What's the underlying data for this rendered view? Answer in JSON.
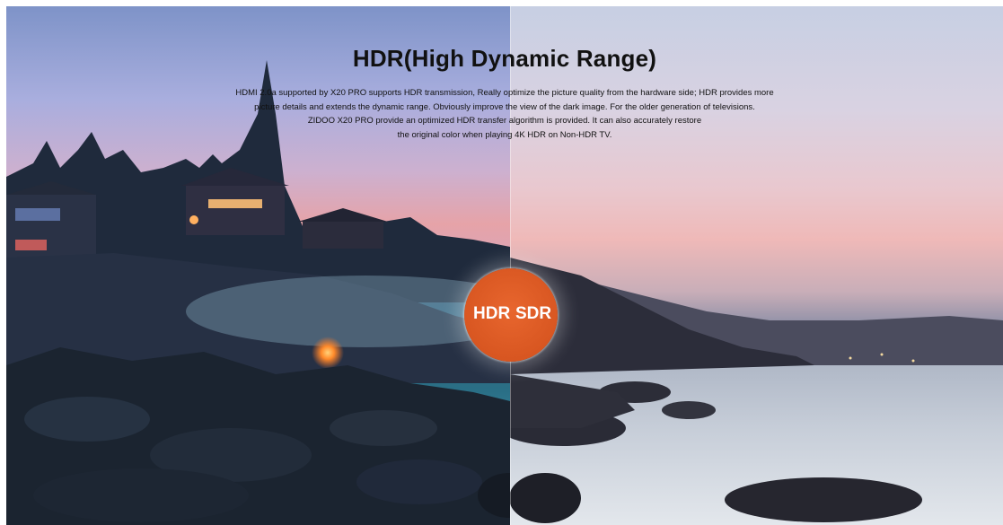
{
  "header": {
    "title": "HDR(High Dynamic Range)",
    "description_lines": [
      "HDMI 2.0a supported by X20 PRO supports HDR transmission, Really optimize the picture quality from the hardware side; HDR provides more",
      "picture details and extends the dynamic range. Obviously improve the view of the dark image. For the older generation of televisions.",
      "ZIDOO X20 PRO provide an optimized HDR transfer algorithm is provided. It can also accurately restore",
      "the original color when playing 4K HDR on Non-HDR TV."
    ]
  },
  "comparison": {
    "left_label": "HDR",
    "right_label": "SDR",
    "badge_color": "#d9581f",
    "scene": "seaside-sunset-with-houses-and-rocks"
  }
}
